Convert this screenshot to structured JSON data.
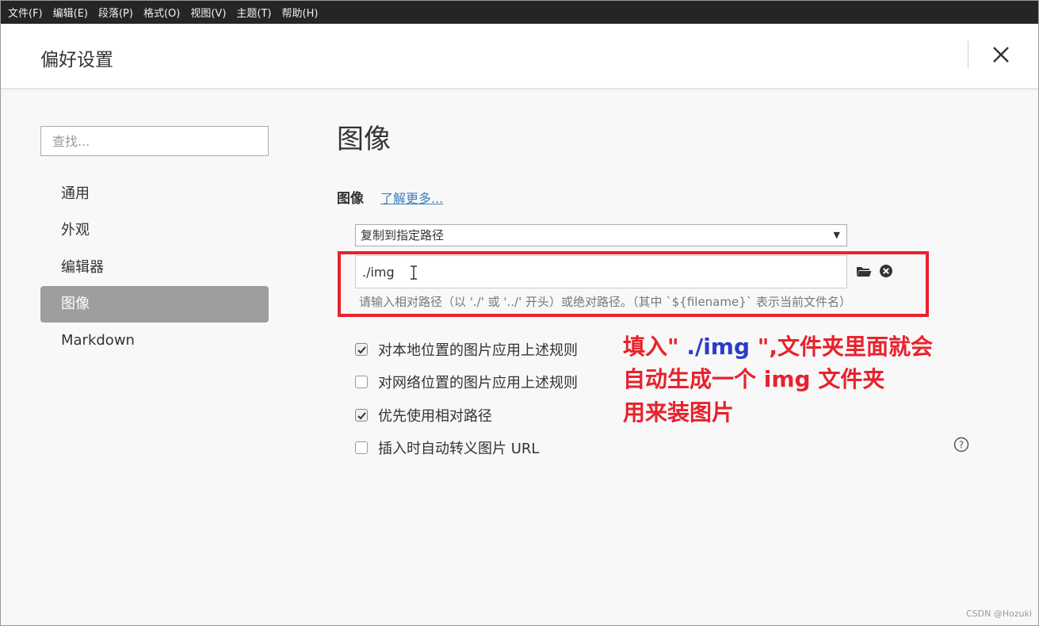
{
  "menubar": {
    "items": [
      "文件(F)",
      "编辑(E)",
      "段落(P)",
      "格式(O)",
      "视图(V)",
      "主题(T)",
      "帮助(H)"
    ]
  },
  "header": {
    "title": "偏好设置"
  },
  "sidebar": {
    "search_placeholder": "查找...",
    "items": [
      {
        "label": "通用"
      },
      {
        "label": "外观"
      },
      {
        "label": "编辑器"
      },
      {
        "label": "图像"
      },
      {
        "label": "Markdown"
      }
    ]
  },
  "main": {
    "title": "图像",
    "section_label": "图像",
    "learn_more": "了解更多...",
    "select_value": "复制到指定路径",
    "path_value": "./img",
    "hint": "请输入相对路径（以 './' 或 '../' 开头）或绝对路径。（其中 `${filename}` 表示当前文件名）",
    "checkboxes": [
      {
        "label": "对本地位置的图片应用上述规则",
        "checked": true
      },
      {
        "label": "对网络位置的图片应用上述规则",
        "checked": false
      },
      {
        "label": "优先使用相对路径",
        "checked": true
      },
      {
        "label": "插入时自动转义图片 URL",
        "checked": false
      }
    ]
  },
  "annotation": {
    "line1_a": "填入\"",
    "line1_b": " ./img ",
    "line1_c": "\",文件夹里面就会",
    "line2": "自动生成一个 img 文件夹",
    "line3": "用来装图片"
  },
  "watermark": "CSDN @Hozuki",
  "colors": {
    "annotation_red": "#e8222d",
    "annotation_blue": "#2c3cc7",
    "link_blue": "#3b7dc1",
    "active_nav": "#9e9e9e"
  }
}
